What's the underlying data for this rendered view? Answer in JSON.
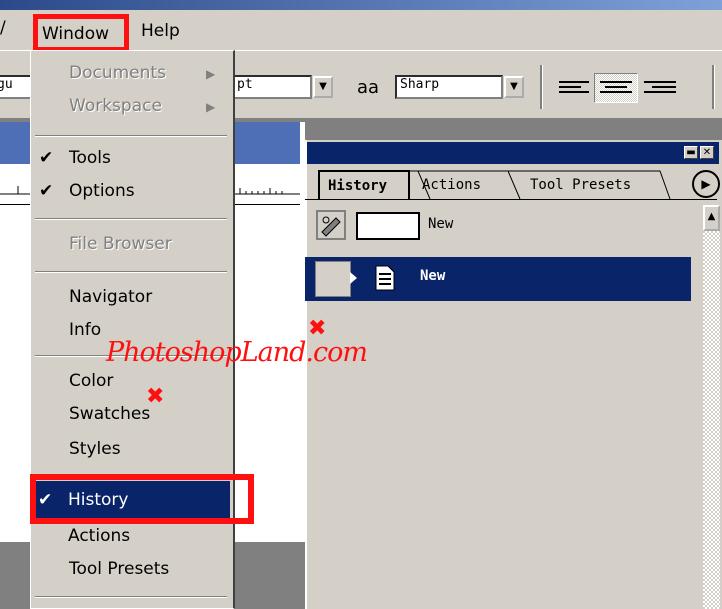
{
  "menubar": {
    "items": [
      {
        "label": "Window"
      },
      {
        "label": "Help"
      }
    ]
  },
  "options_bar": {
    "font_style_value": "gu",
    "font_size_value": "pt",
    "aa_icon": "aa",
    "anti_alias_value": "Sharp"
  },
  "window_menu": {
    "items": [
      {
        "label": "Documents",
        "enabled": false,
        "submenu": true
      },
      {
        "label": "Workspace",
        "enabled": false,
        "submenu": true
      },
      {
        "label": "Tools",
        "checked": true
      },
      {
        "label": "Options",
        "checked": true
      },
      {
        "label": "File Browser",
        "enabled": false
      },
      {
        "label": "Navigator"
      },
      {
        "label": "Info"
      },
      {
        "label": "Color"
      },
      {
        "label": "Swatches"
      },
      {
        "label": "Styles"
      },
      {
        "label": "History",
        "checked": true,
        "highlighted": true
      },
      {
        "label": "Actions"
      },
      {
        "label": "Tool Presets"
      }
    ],
    "check_glyph": "✔",
    "arrow_glyph": "▶"
  },
  "history_panel": {
    "tabs": [
      {
        "label": "History",
        "active": true
      },
      {
        "label": "Actions"
      },
      {
        "label": "Tool Presets"
      }
    ],
    "snapshot_label": "New",
    "states": [
      {
        "label": "New",
        "selected": true
      }
    ]
  },
  "watermark": "PhotoshopLand.com",
  "colors": {
    "highlight": "#0a246a",
    "annotation_red": "#ff1010",
    "chrome": "#d4d0c8"
  }
}
